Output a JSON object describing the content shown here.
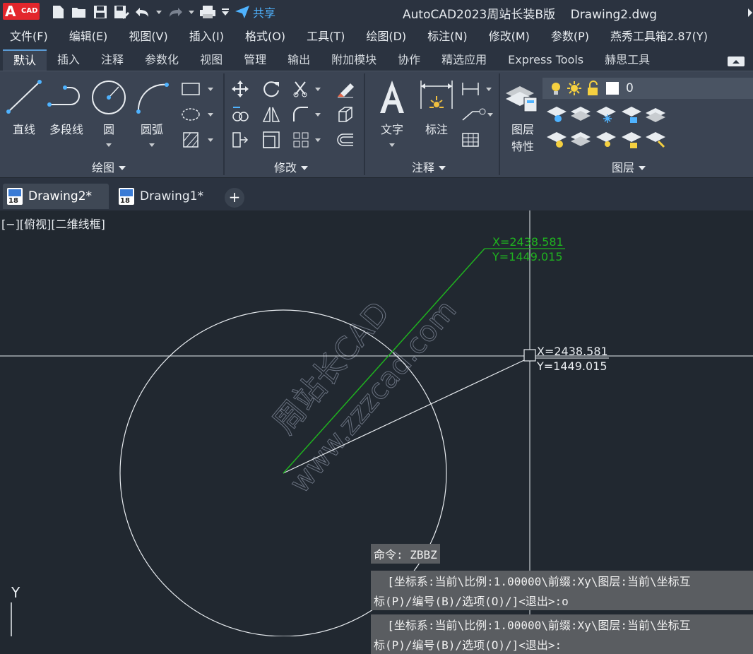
{
  "title_bar": {
    "app_badge_letter": "A",
    "app_badge_text": "CAD",
    "share_label": "共享",
    "window_title": "AutoCAD2023周站长装B版    Drawing2.dwg"
  },
  "menu": [
    "文件(F)",
    "编辑(E)",
    "视图(V)",
    "插入(I)",
    "格式(O)",
    "工具(T)",
    "绘图(D)",
    "标注(N)",
    "修改(M)",
    "参数(P)",
    "燕秀工具箱2.87(Y)"
  ],
  "ribbon_tabs": [
    "默认",
    "插入",
    "注释",
    "参数化",
    "视图",
    "管理",
    "输出",
    "附加模块",
    "协作",
    "精选应用",
    "Express Tools",
    "赫思工具"
  ],
  "ribbon": {
    "draw": {
      "line": "直线",
      "polyline": "多段线",
      "circle": "圆",
      "arc": "圆弧",
      "panel": "绘图"
    },
    "modify": {
      "panel": "修改"
    },
    "annotate": {
      "text": "文字",
      "dimension": "标注",
      "panel": "注释"
    },
    "layers": {
      "properties_line1": "图层",
      "properties_line2": "特性",
      "current_layer": "0",
      "panel": "图层"
    }
  },
  "doc_tabs": [
    {
      "name": "Drawing2*",
      "active": true
    },
    {
      "name": "Drawing1*",
      "active": false
    }
  ],
  "viewport": {
    "view_label": "[−][俯视][二维线框]",
    "watermark_cn": "周站长CAD",
    "watermark_url": "www.zzzcad.com",
    "green_x": "X=2438.581",
    "green_y": "Y=1449.015",
    "cursor_x": "X=2438.581",
    "cursor_y": "Y=1449.015",
    "ucs_y": "Y"
  },
  "command": {
    "cmd": "命令: ZBBZ",
    "line1a": "  [坐标系:当前\\比例:1.00000\\前缀:Xy\\图层:当前\\坐标互",
    "line1b": "标(P)/编号(B)/选项(O)/]<退出>:o",
    "line2a": "  [坐标系:当前\\比例:1.00000\\前缀:Xy\\图层:当前\\坐标互",
    "line2b": "标(P)/编号(B)/选项(O)/]<退出>:"
  },
  "colors": {
    "green_line": "#1fb31f",
    "background": "#212830",
    "ribbon": "#3b4453"
  }
}
